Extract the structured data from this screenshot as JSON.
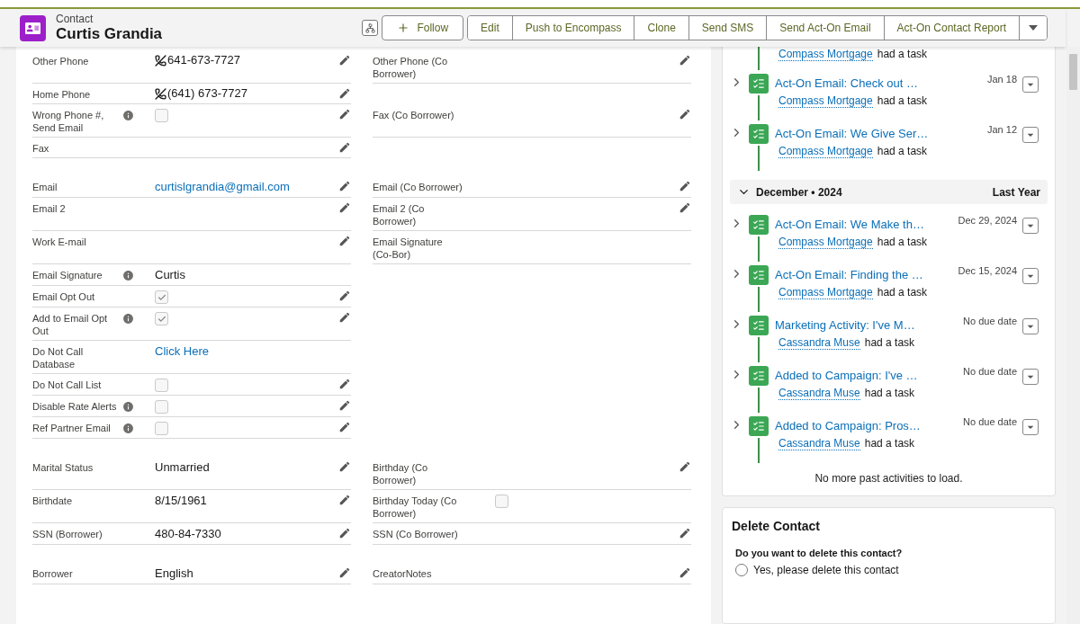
{
  "header": {
    "object_type": "Contact",
    "title": "Curtis Grandia",
    "actions": [
      {
        "label": "Follow",
        "kind": "follow"
      },
      {
        "label": "Edit",
        "kind": "plain"
      },
      {
        "label": "Push to Encompass",
        "kind": "plain"
      },
      {
        "label": "Clone",
        "kind": "plain"
      },
      {
        "label": "Send SMS",
        "kind": "plain"
      },
      {
        "label": "Send Act-On Email",
        "kind": "plain"
      },
      {
        "label": "Act-On Contact Report",
        "kind": "plain"
      }
    ]
  },
  "details": {
    "sections": [
      {
        "rows": [
          [
            {
              "label": "Other Phone",
              "kind": "phone",
              "value": "641-673-7727",
              "editable": true
            },
            {
              "label": "Other Phone (Co Borrower)",
              "kind": "empty",
              "editable": true
            }
          ],
          [
            {
              "label": "Home Phone",
              "kind": "phone",
              "value": "(641) 673-7727",
              "editable": true
            },
            null
          ],
          [
            {
              "label": "Wrong Phone #, Send Email",
              "kind": "checkbox",
              "checked": false,
              "info": true,
              "editable": true
            },
            {
              "label": "Fax (Co Borrower)",
              "kind": "empty",
              "editable": true
            }
          ],
          [
            {
              "label": "Fax",
              "kind": "empty",
              "editable": true
            },
            null
          ]
        ]
      },
      {
        "rows": [
          [
            {
              "label": "Email",
              "kind": "link",
              "value": "curtislgrandia@gmail.com",
              "editable": true
            },
            {
              "label": "Email (Co Borrower)",
              "kind": "empty",
              "editable": true
            }
          ],
          [
            {
              "label": "Email 2",
              "kind": "empty",
              "editable": true
            },
            {
              "label": "Email 2 (Co Borrower)",
              "kind": "empty",
              "editable": true
            }
          ],
          [
            {
              "label": "Work E-mail",
              "kind": "empty",
              "editable": true
            },
            {
              "label": "Email Signature (Co-Bor)",
              "kind": "empty",
              "editable": false
            }
          ],
          [
            {
              "label": "Email Signature",
              "kind": "text",
              "value": "Curtis",
              "info": true,
              "editable": false
            },
            null
          ],
          [
            {
              "label": "Email Opt Out",
              "kind": "checkbox",
              "checked": true,
              "editable": true
            },
            null
          ],
          [
            {
              "label": "Add to Email Opt Out",
              "kind": "checkbox",
              "checked": true,
              "info": true,
              "editable": true
            },
            null
          ],
          [
            {
              "label": "Do Not Call Database",
              "kind": "link",
              "value": "Click Here",
              "editable": false
            },
            null
          ],
          [
            {
              "label": "Do Not Call List",
              "kind": "checkbox",
              "checked": false,
              "editable": true
            },
            null
          ],
          [
            {
              "label": "Disable Rate Alerts",
              "kind": "checkbox",
              "checked": false,
              "info": true,
              "editable": true
            },
            null
          ],
          [
            {
              "label": "Ref Partner Email",
              "kind": "checkbox",
              "checked": false,
              "info": true,
              "editable": true
            },
            null
          ]
        ]
      },
      {
        "rows": [
          [
            {
              "label": "Marital Status",
              "kind": "text",
              "value": "Unmarried",
              "editable": true
            },
            {
              "label": "Birthday (Co Borrower)",
              "kind": "empty",
              "editable": true
            }
          ],
          [
            {
              "label": "Birthdate",
              "kind": "text",
              "value": "8/15/1961",
              "editable": true
            },
            {
              "label": "Birthday Today (Co Borrower)",
              "kind": "checkbox",
              "checked": false,
              "editable": false
            }
          ],
          [
            {
              "label": "SSN (Borrower)",
              "kind": "text",
              "value": "480-84-7330",
              "editable": true
            },
            {
              "label": "SSN (Co Borrower)",
              "kind": "empty",
              "editable": true
            }
          ]
        ]
      },
      {
        "rows": [
          [
            {
              "label": "Borrower",
              "kind": "text",
              "value": "English",
              "editable": true
            },
            {
              "label": "CreatorNotes",
              "kind": "empty",
              "editable": true
            }
          ]
        ]
      }
    ]
  },
  "activity": {
    "groups": [
      {
        "items": [
          {
            "who": "Compass Mortgage",
            "action": "had a task"
          },
          {
            "title": "Act-On Email: Check out …",
            "date": "Jan 18",
            "who": "Compass Mortgage",
            "action": "had a task"
          },
          {
            "title": "Act-On Email: We Give Ser…",
            "date": "Jan 12",
            "who": "Compass Mortgage",
            "action": "had a task"
          }
        ]
      },
      {
        "month": "December • 2024",
        "relative": "Last Year",
        "expanded": true,
        "items": [
          {
            "title": "Act-On Email: We Make th…",
            "date": "Dec 29, 2024",
            "who": "Compass Mortgage",
            "action": "had a task"
          },
          {
            "title": "Act-On Email: Finding the …",
            "date": "Dec 15, 2024",
            "who": "Compass Mortgage",
            "action": "had a task"
          },
          {
            "title": "Marketing Activity: I've M…",
            "date": "No due date",
            "who": "Cassandra Muse",
            "action": "had a task"
          },
          {
            "title": "Added to Campaign: I've …",
            "date": "No due date",
            "who": "Cassandra Muse",
            "action": "had a task"
          },
          {
            "title": "Added to Campaign: Pros…",
            "date": "No due date",
            "who": "Cassandra Muse",
            "action": "had a task"
          }
        ]
      }
    ],
    "footer": "No more past activities to load."
  },
  "delete_card": {
    "title": "Delete Contact",
    "question": "Do you want to delete this contact?",
    "options": [
      {
        "label": "Yes, please delete this contact",
        "selected": false
      }
    ]
  }
}
